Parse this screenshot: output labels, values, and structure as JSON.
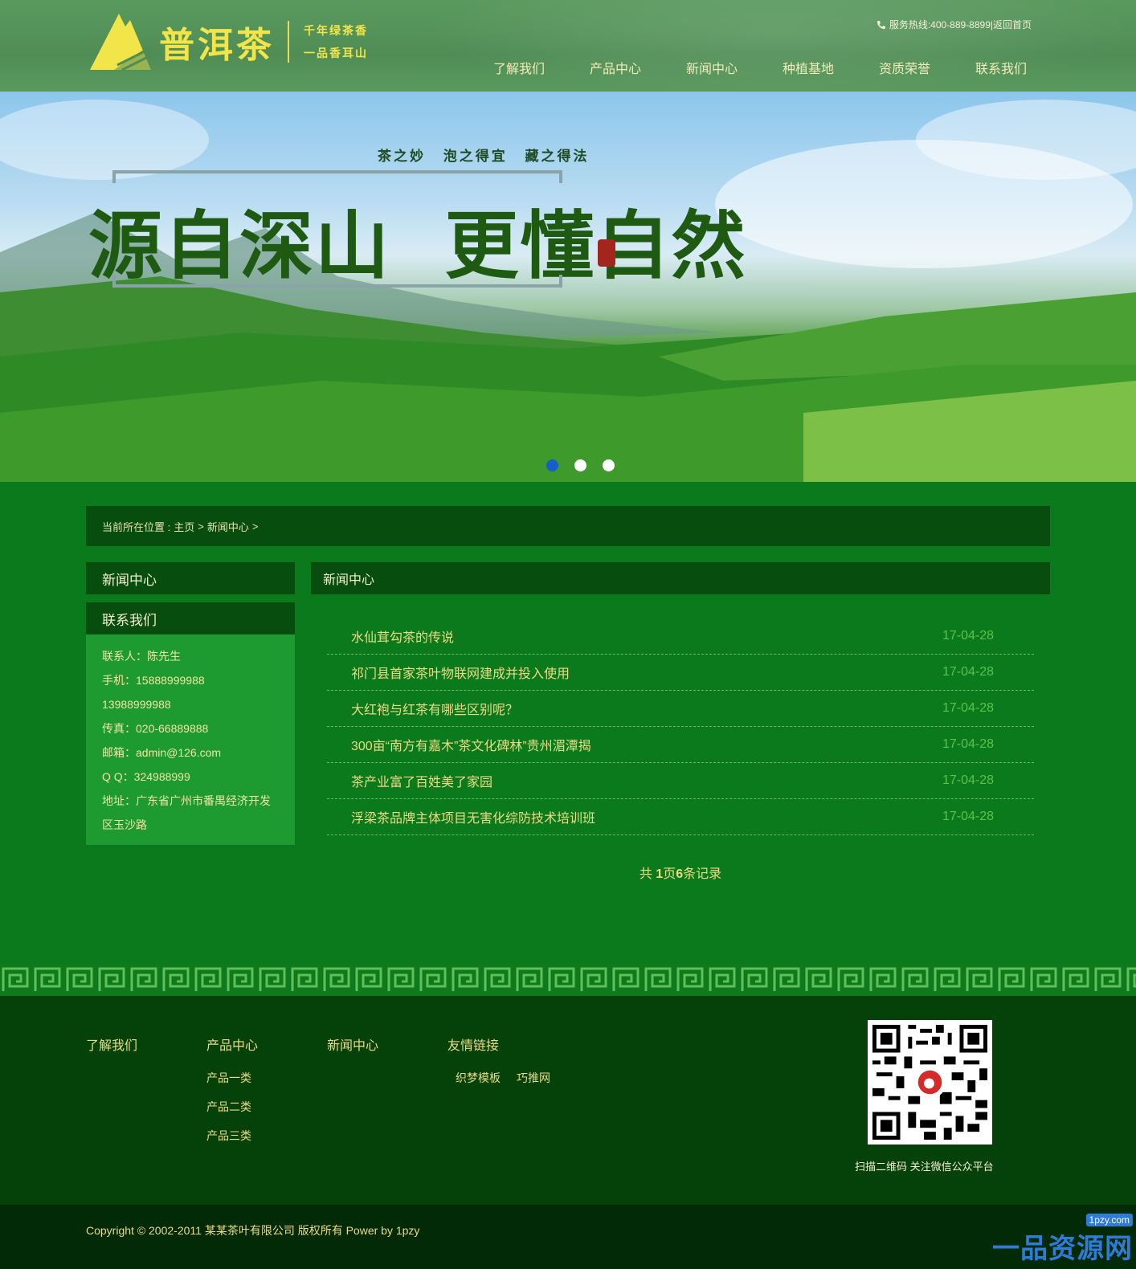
{
  "header": {
    "brand_name": "普洱茶",
    "slogan_line1": "千年绿茶香",
    "slogan_line2": "一品香耳山",
    "hotline": "服务热线:400-889-8899|返回首页",
    "nav": [
      "了解我们",
      "产品中心",
      "新闻中心",
      "种植基地",
      "资质荣誉",
      "联系我们"
    ]
  },
  "banner": {
    "subtitle": "茶之妙  泡之得宜  藏之得法",
    "title": "源自深山  更懂自然",
    "dots": 3,
    "active_dot": 0
  },
  "breadcrumb": {
    "prefix": "当前所在位置 :",
    "home": "主页",
    "sep": ">",
    "current": "新闻中心",
    "sep2": ">"
  },
  "sidebar": {
    "news_head": "新闻中心",
    "contact_head": "联系我们",
    "contact_lines": [
      "联系人：陈先生",
      "手机：15888999988",
      "13988999988",
      "传真：020-66889888",
      "邮箱：admin@126.com",
      "Q Q：324988999",
      "地址：广东省广州市番禺经济开发",
      "区玉沙路"
    ]
  },
  "content": {
    "head": "新闻中心",
    "news": [
      {
        "title": "水仙茸勾茶的传说",
        "date": "17-04-28"
      },
      {
        "title": "祁门县首家茶叶物联网建成并投入使用",
        "date": "17-04-28"
      },
      {
        "title": "大红袍与红茶有哪些区别呢？",
        "date": "17-04-28"
      },
      {
        "title": "300亩“南方有嘉木”茶文化碑林”贵州湄潭揭",
        "date": "17-04-28"
      },
      {
        "title": "茶产业富了百姓美了家园",
        "date": "17-04-28"
      },
      {
        "title": "浮梁茶品牌主体项目无害化综防技术培训班",
        "date": "17-04-28"
      }
    ],
    "pager": {
      "pre": "共 ",
      "pages": "1",
      "mid": "页",
      "records": "6",
      "post": "条记录"
    }
  },
  "footer": {
    "col1_head": "了解我们",
    "col2_head": "产品中心",
    "col2_links": [
      "产品一类",
      "产品二类",
      "产品三类"
    ],
    "col3_head": "新闻中心",
    "col4_head": "友情链接",
    "friend_links": [
      "织梦模板",
      "巧推网"
    ],
    "qr_caption": "扫描二维码 关注微信公众平台",
    "copyright": "Copyright © 2002-2011 某某茶叶有限公司 版权所有 Power by 1pzy"
  },
  "watermark": {
    "logo": "一品资源网",
    "url": "1pzy.com"
  },
  "colors": {
    "brand_yellow": "#f2e54a",
    "dark_green": "#064d0e",
    "page_green": "#0a7a1c",
    "text_gold": "#ecdb85",
    "date_green": "#5fc04a"
  }
}
